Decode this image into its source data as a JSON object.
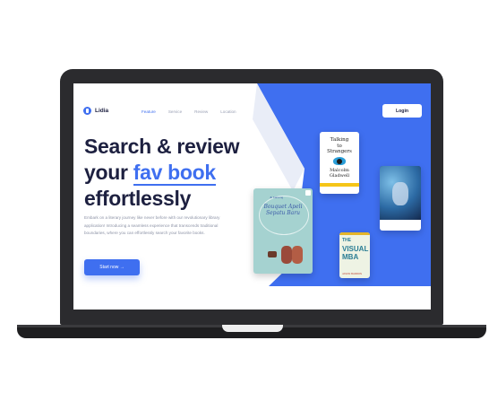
{
  "app": {
    "name": "Lidia"
  },
  "nav": {
    "links": [
      "Feature",
      "Service",
      "Review",
      "Location"
    ],
    "active_index": 0,
    "login_label": "Login"
  },
  "hero": {
    "line1": "Search & review",
    "line2_prefix": "your ",
    "line2_accent": "fav book",
    "line3": "effortlessly",
    "paragraph": "Embark on a literary journey like never before with our revolutionary library application! Introducing a seamless experience that transcends traditional boundaries, where you can effortlessly search your favorite books.",
    "cta_label": "Start now →"
  },
  "books": {
    "talking": {
      "title_l1": "Talking",
      "title_l2": "to",
      "title_l3": "Strangers",
      "author_l1": "Malcolm",
      "author_l2": "Gladwell"
    },
    "bouquet": {
      "author": "Jk Karueng",
      "title_l1": "Bouquet Apeli",
      "title_l2": "Sepatu Baru"
    },
    "visual": {
      "title_l1": "THE",
      "title_l2": "VISUAL",
      "title_l3": "MBA",
      "author": "JASON BARRON"
    }
  },
  "colors": {
    "accent": "#3f6ff0",
    "dark": "#1d2040",
    "laptop": "#2b2b2e"
  }
}
